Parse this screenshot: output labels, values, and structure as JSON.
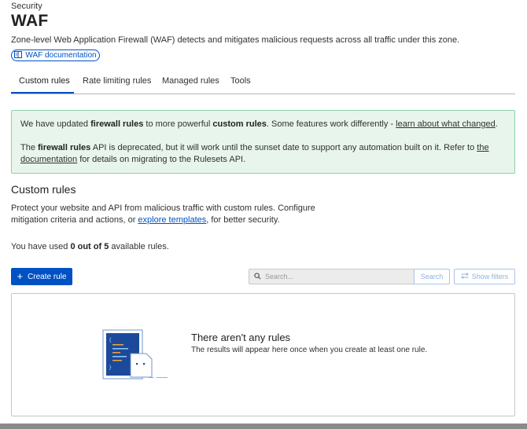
{
  "breadcrumb": "Security",
  "page_title": "WAF",
  "page_description": "Zone-level Web Application Firewall (WAF) detects and mitigates malicious requests across all traffic under this zone.",
  "doc_link_label": "WAF documentation",
  "tabs": [
    {
      "label": "Custom rules",
      "active": true
    },
    {
      "label": "Rate limiting rules",
      "active": false
    },
    {
      "label": "Managed rules",
      "active": false
    },
    {
      "label": "Tools",
      "active": false
    }
  ],
  "notice": {
    "line1_pre": "We have updated ",
    "line1_bold1": "firewall rules",
    "line1_mid": " to more powerful ",
    "line1_bold2": "custom rules",
    "line1_post": ". Some features work differently - ",
    "line1_link": "learn about what changed",
    "line1_end": ".",
    "line2_pre": "The ",
    "line2_bold": "firewall rules",
    "line2_mid": " API is deprecated, but it will work until the sunset date to support any automation built on it. Refer to ",
    "line2_link": "the documentation",
    "line2_post": " for details on migrating to the Rulesets API."
  },
  "section": {
    "title": "Custom rules",
    "desc_pre": "Protect your website and API from malicious traffic with custom rules. Configure mitigation criteria and actions, or ",
    "desc_link": "explore templates",
    "desc_post": ", for better security."
  },
  "usage": {
    "pre": "You have used ",
    "bold": "0 out of 5",
    "post": " available rules."
  },
  "create_button_label": "Create rule",
  "search": {
    "placeholder": "Search...",
    "button_label": "Search"
  },
  "show_filters_label": "Show filters",
  "empty_state": {
    "title": "There aren't any rules",
    "description": "The results will appear here once when you create at least one rule."
  },
  "colors": {
    "accent": "#0051c3",
    "notice_bg": "#e8f5ec",
    "notice_border": "#8fd1a6"
  }
}
